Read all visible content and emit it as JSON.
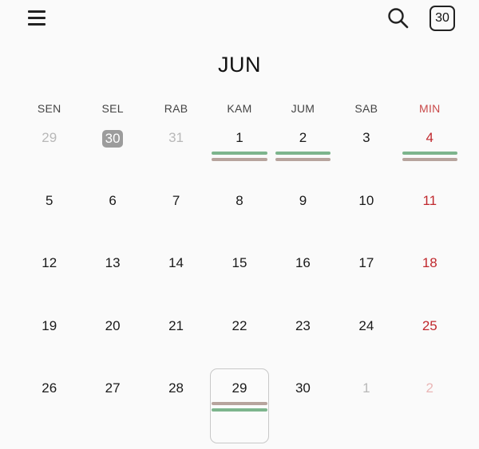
{
  "header": {
    "today_label": "30",
    "month_title": "JUN"
  },
  "weekdays": [
    "SEN",
    "SEL",
    "RAB",
    "KAM",
    "JUM",
    "SAB",
    "MIN"
  ],
  "colors": {
    "event_green": "#7db58d",
    "event_taupe": "#b7a49d",
    "sunday_red": "#c0282d"
  },
  "weeks": [
    [
      {
        "day": "29",
        "outside": true
      },
      {
        "day": "30",
        "outside": true,
        "today": true
      },
      {
        "day": "31",
        "outside": true
      },
      {
        "day": "1",
        "events": [
          "event_green",
          "event_taupe"
        ]
      },
      {
        "day": "2",
        "events": [
          "event_green",
          "event_taupe"
        ]
      },
      {
        "day": "3"
      },
      {
        "day": "4",
        "events": [
          "event_green",
          "event_taupe"
        ]
      }
    ],
    [
      {
        "day": "5"
      },
      {
        "day": "6"
      },
      {
        "day": "7"
      },
      {
        "day": "8"
      },
      {
        "day": "9"
      },
      {
        "day": "10"
      },
      {
        "day": "11"
      }
    ],
    [
      {
        "day": "12"
      },
      {
        "day": "13"
      },
      {
        "day": "14"
      },
      {
        "day": "15"
      },
      {
        "day": "16"
      },
      {
        "day": "17"
      },
      {
        "day": "18"
      }
    ],
    [
      {
        "day": "19"
      },
      {
        "day": "20"
      },
      {
        "day": "21"
      },
      {
        "day": "22"
      },
      {
        "day": "23"
      },
      {
        "day": "24"
      },
      {
        "day": "25"
      }
    ],
    [
      {
        "day": "26"
      },
      {
        "day": "27"
      },
      {
        "day": "28"
      },
      {
        "day": "29",
        "selected": true,
        "events": [
          "event_taupe",
          "event_green"
        ]
      },
      {
        "day": "30"
      },
      {
        "day": "1",
        "outside": true
      },
      {
        "day": "2",
        "outside": true
      }
    ]
  ]
}
